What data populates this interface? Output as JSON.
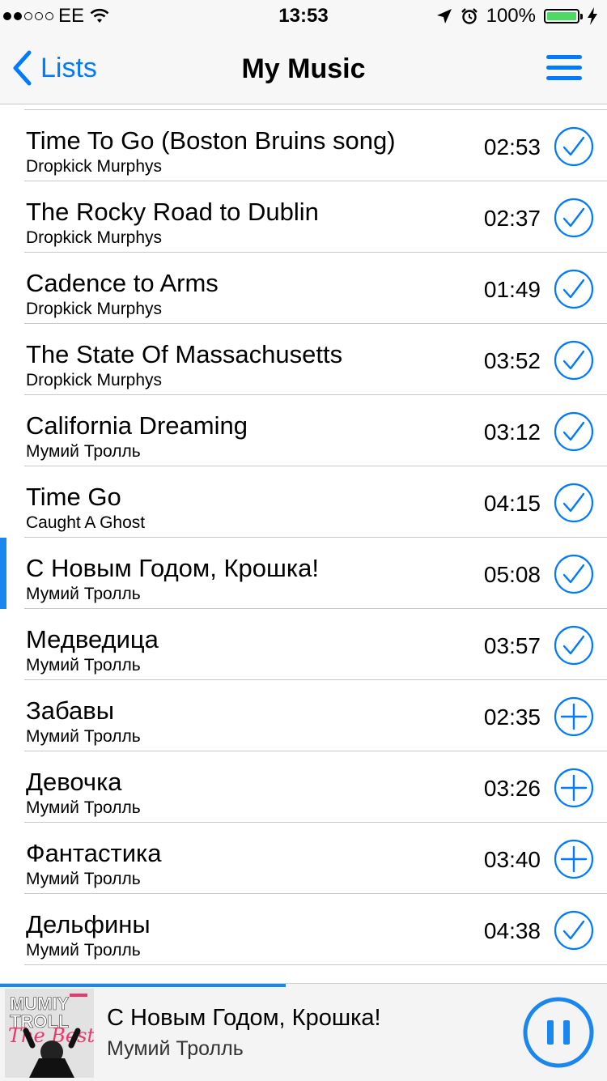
{
  "status_bar": {
    "carrier": "EE",
    "time": "13:53",
    "battery": "100%",
    "signal_bars_filled": 2,
    "signal_bars_total": 5
  },
  "nav": {
    "back_label": "Lists",
    "title": "My Music"
  },
  "colors": {
    "accent": "#007aff",
    "active_bar": "#1a86f0",
    "battery_fill": "#4cd964"
  },
  "tracks": [
    {
      "title": "Time To Go (Boston Bruins song)",
      "artist": "Dropkick Murphys",
      "duration": "02:53",
      "status": "added"
    },
    {
      "title": "The Rocky Road to Dublin",
      "artist": "Dropkick Murphys",
      "duration": "02:37",
      "status": "added"
    },
    {
      "title": "Cadence to Arms",
      "artist": "Dropkick Murphys",
      "duration": "01:49",
      "status": "added"
    },
    {
      "title": "The State Of Massachusetts",
      "artist": "Dropkick Murphys",
      "duration": "03:52",
      "status": "added"
    },
    {
      "title": "California Dreaming",
      "artist": "Мумий Тролль",
      "duration": "03:12",
      "status": "added"
    },
    {
      "title": "Time Go",
      "artist": "Caught A Ghost",
      "duration": "04:15",
      "status": "added"
    },
    {
      "title": "С Новым Годом, Крошка!",
      "artist": "Мумий Тролль",
      "duration": "05:08",
      "status": "added",
      "playing": true
    },
    {
      "title": "Медведица",
      "artist": "Мумий Тролль",
      "duration": "03:57",
      "status": "added"
    },
    {
      "title": "Забавы",
      "artist": "Мумий Тролль",
      "duration": "02:35",
      "status": "add"
    },
    {
      "title": "Девочка",
      "artist": "Мумий Тролль",
      "duration": "03:26",
      "status": "add"
    },
    {
      "title": "Фантастика",
      "artist": "Мумий Тролль",
      "duration": "03:40",
      "status": "add"
    },
    {
      "title": "Дельфины",
      "artist": "Мумий Тролль",
      "duration": "04:38",
      "status": "added"
    }
  ],
  "player": {
    "title": "С Новым Годом, Крошка!",
    "artist": "Мумий Тролль",
    "progress_fraction": 0.47,
    "cover_text_1": "MUMIY",
    "cover_text_2": "TROLL",
    "cover_text_3": "The Best"
  }
}
